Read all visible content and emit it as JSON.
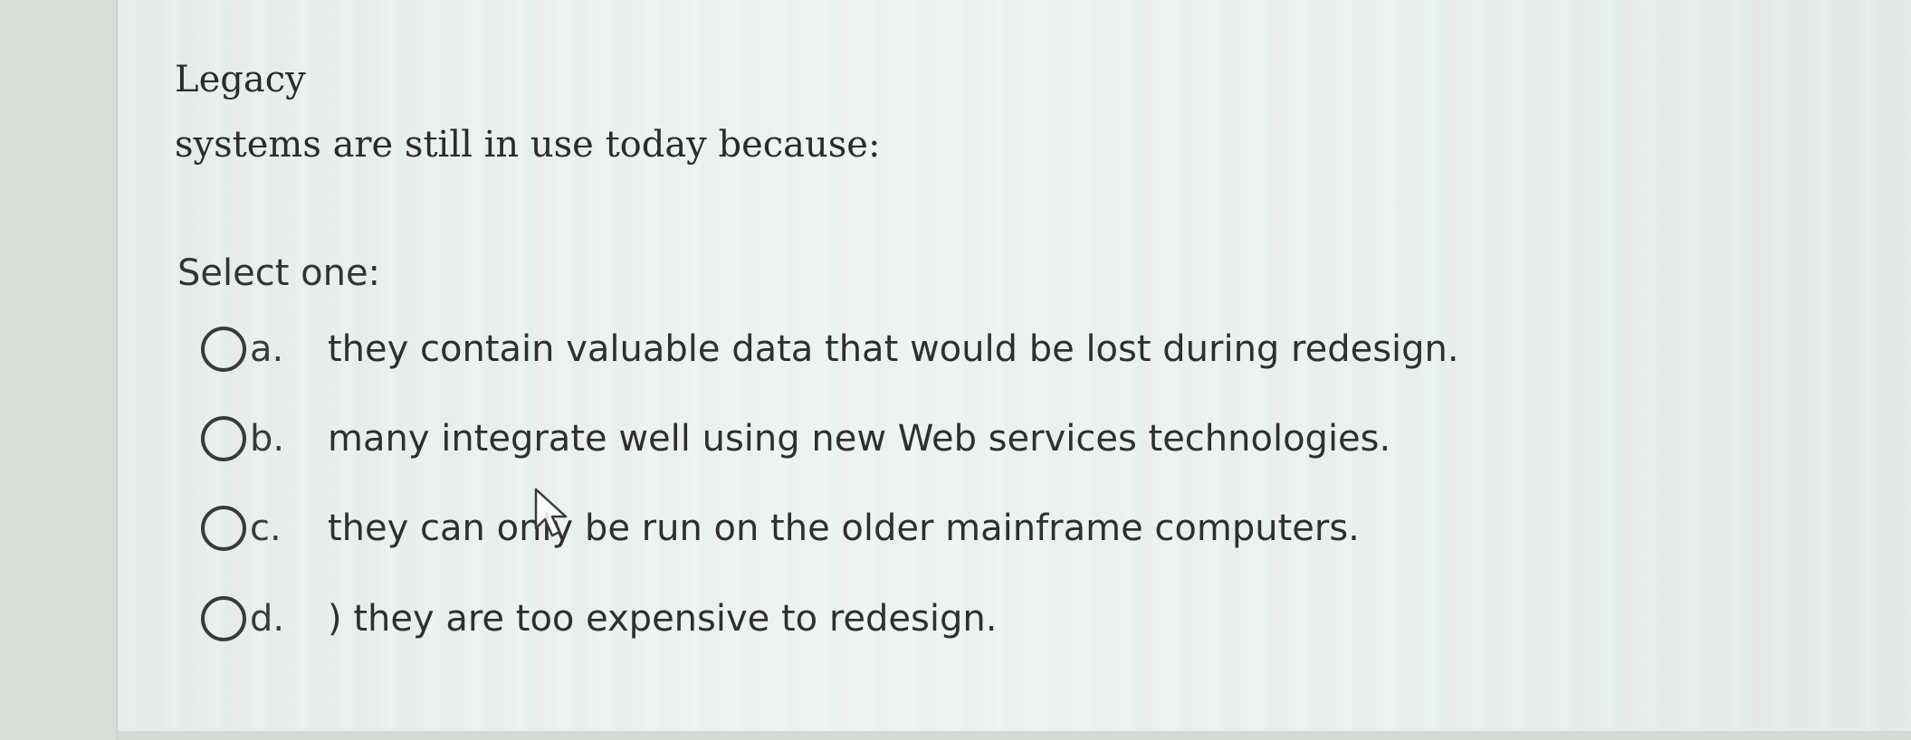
{
  "question": {
    "line1": "Legacy",
    "line2": "systems are still in use today because:"
  },
  "prompt": "Select one:",
  "options": [
    {
      "letter": "a.",
      "text": "they contain valuable data that would be lost during redesign."
    },
    {
      "letter": "b.",
      "text": "many integrate well using new Web services technologies."
    },
    {
      "letter": "c.",
      "text": "they can only be run on the older mainframe computers."
    },
    {
      "letter": "d.",
      "text": ") they are too expensive to redesign."
    }
  ],
  "icons": {
    "radio": "radio-unselected-icon",
    "cursor": "mouse-pointer-icon"
  },
  "colors": {
    "text": "#2f2f2f",
    "radio_border": "#3a3a3a",
    "background": "#e9efed"
  }
}
